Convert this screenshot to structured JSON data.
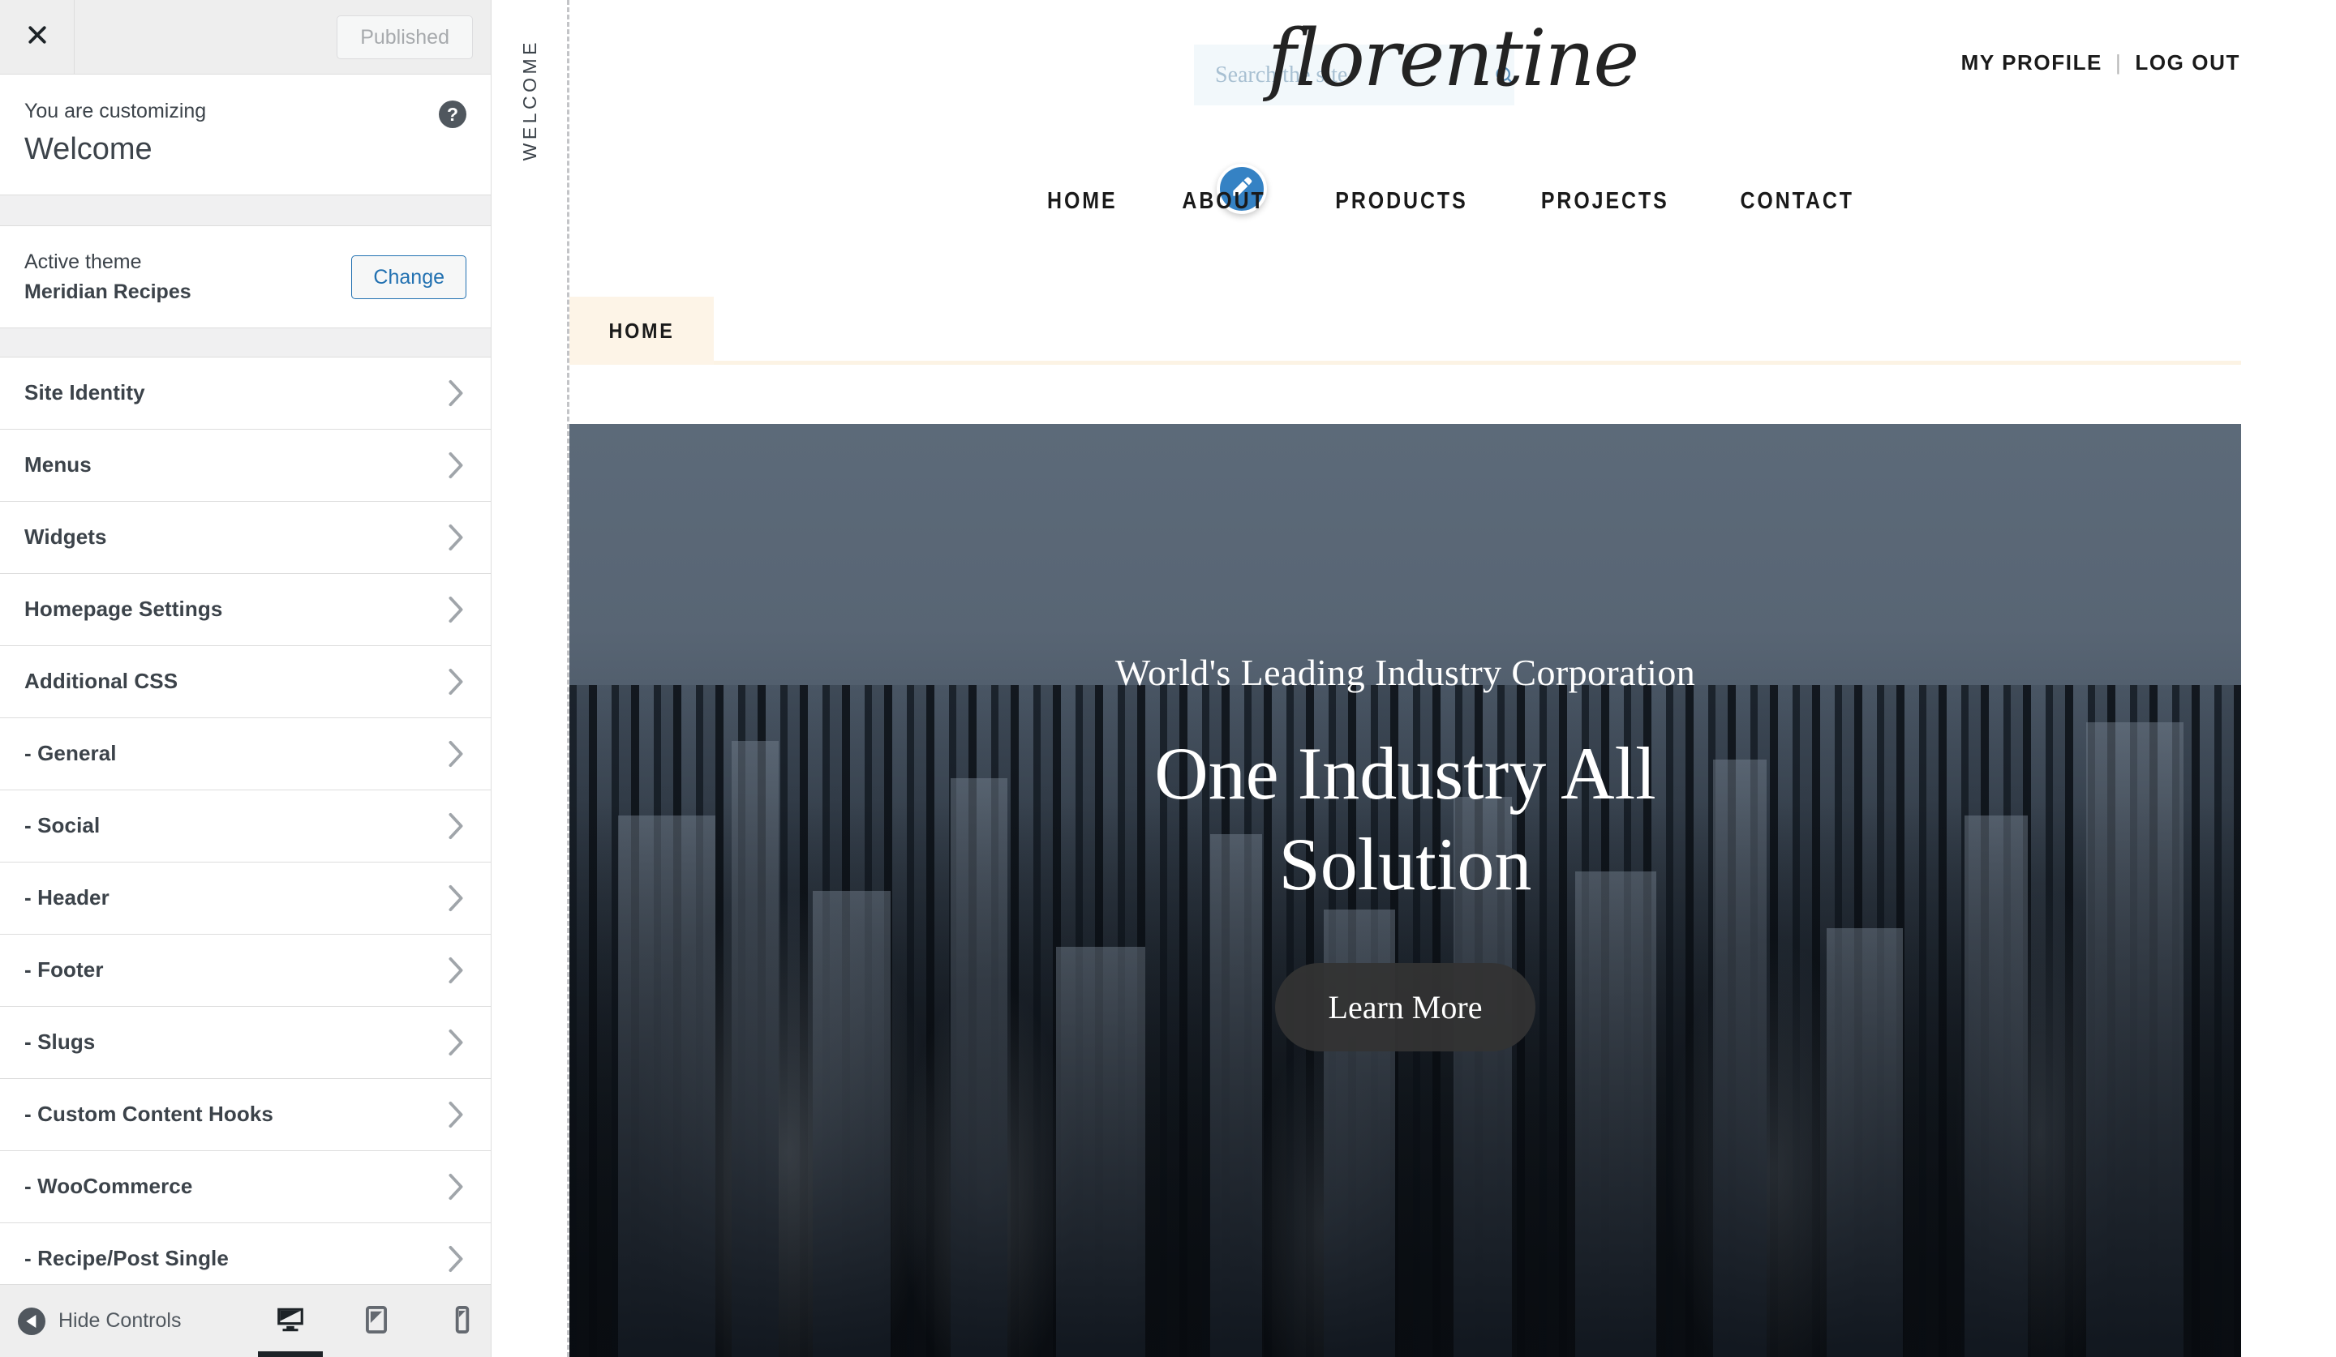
{
  "customizer": {
    "close_icon": "close-icon",
    "publish_label": "Published",
    "info_label": "You are customizing",
    "info_title": "Welcome",
    "help_icon": "?",
    "theme_label": "Active theme",
    "theme_name": "Meridian Recipes",
    "change_label": "Change",
    "sections": [
      {
        "label": "Site Identity"
      },
      {
        "label": "Menus"
      },
      {
        "label": "Widgets"
      },
      {
        "label": "Homepage Settings"
      },
      {
        "label": "Additional CSS"
      },
      {
        "label": "- General"
      },
      {
        "label": "- Social"
      },
      {
        "label": "- Header"
      },
      {
        "label": "- Footer"
      },
      {
        "label": "- Slugs"
      },
      {
        "label": "- Custom Content Hooks"
      },
      {
        "label": "- WooCommerce"
      },
      {
        "label": "- Recipe/Post Single"
      }
    ],
    "footer": {
      "hide_controls_label": "Hide Controls",
      "devices": [
        {
          "name": "desktop",
          "active": true
        },
        {
          "name": "tablet",
          "active": false
        },
        {
          "name": "mobile",
          "active": false
        }
      ]
    }
  },
  "preview": {
    "rail_label": "WELCOME",
    "site": {
      "search": {
        "placeholder": "Search the site",
        "value": "",
        "icon": "search-icon"
      },
      "edit_shortcut_icon": "pencil-icon",
      "logo_text": "florentine",
      "account": {
        "profile_label": "MY PROFILE",
        "divider": "|",
        "logout_label": "LOG OUT"
      },
      "nav": [
        {
          "label": "HOME"
        },
        {
          "label": "ABOUT"
        },
        {
          "label": "PRODUCTS"
        },
        {
          "label": "PROJECTS"
        },
        {
          "label": "CONTACT"
        }
      ],
      "breadcrumb": {
        "label": "HOME"
      },
      "hero": {
        "eyebrow": "World's Leading Industry Corporation",
        "title": "One Industry All Solution",
        "button_label": "Learn More"
      }
    }
  },
  "colors": {
    "accent_blue": "#2271b1",
    "pencil_blue": "#3582c4",
    "sidebar_bg": "#ffffff",
    "topbar_bg": "#eeeeee",
    "tab_cream": "#fdf4e7",
    "hero_sky": "#5c6a79",
    "hero_btn": "#333333"
  }
}
